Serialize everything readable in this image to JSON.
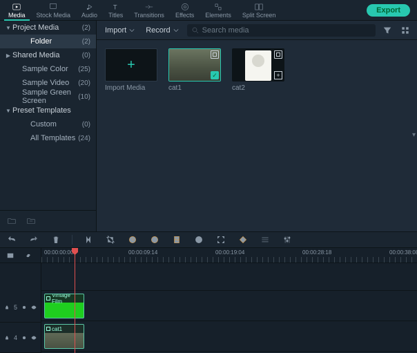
{
  "topTabs": [
    {
      "id": "media",
      "label": "Media"
    },
    {
      "id": "stock",
      "label": "Stock Media"
    },
    {
      "id": "audio",
      "label": "Audio"
    },
    {
      "id": "titles",
      "label": "Titles"
    },
    {
      "id": "transitions",
      "label": "Transitions"
    },
    {
      "id": "effects",
      "label": "Effects"
    },
    {
      "id": "elements",
      "label": "Elements"
    },
    {
      "id": "split",
      "label": "Split Screen"
    }
  ],
  "activeTopTab": "media",
  "exportLabel": "Export",
  "sidebar": [
    {
      "id": "projectmedia",
      "label": "Project Media",
      "count": "(2)",
      "tri": "▼",
      "indent": 0,
      "header": true
    },
    {
      "id": "folder",
      "label": "Folder",
      "count": "(2)",
      "indent": 2,
      "selected": true
    },
    {
      "id": "sharedmedia",
      "label": "Shared Media",
      "count": "(0)",
      "tri": "▶",
      "indent": 0,
      "header": true
    },
    {
      "id": "samplecolor",
      "label": "Sample Color",
      "count": "(25)",
      "indent": 1
    },
    {
      "id": "samplevideo",
      "label": "Sample Video",
      "count": "(20)",
      "indent": 1
    },
    {
      "id": "samplegreen",
      "label": "Sample Green Screen",
      "count": "(10)",
      "indent": 1
    },
    {
      "id": "preset",
      "label": "Preset Templates",
      "tri": "▼",
      "indent": 0,
      "header": true
    },
    {
      "id": "custom",
      "label": "Custom",
      "count": "(0)",
      "indent": 2
    },
    {
      "id": "alltemplates",
      "label": "All Templates",
      "count": "(24)",
      "indent": 2
    }
  ],
  "toolbar": {
    "import": "Import",
    "record": "Record",
    "searchPlaceholder": "Search media"
  },
  "mediaItems": [
    {
      "id": "import",
      "label": "Import Media",
      "import": true
    },
    {
      "id": "cat1",
      "label": "cat1",
      "selected": true,
      "thumb": "cat1"
    },
    {
      "id": "cat2",
      "label": "cat2",
      "thumb": "cat2"
    }
  ],
  "ruler": {
    "marks": [
      {
        "pos": 4,
        "label": "00:00:00:00"
      },
      {
        "pos": 126,
        "label": "00:00:09:14"
      },
      {
        "pos": 252,
        "label": "00:00:19:04"
      },
      {
        "pos": 378,
        "label": "00:00:28:18"
      },
      {
        "pos": 504,
        "label": "00:00:38:08"
      }
    ]
  },
  "tracks": [
    {
      "id": "5",
      "clips": [
        {
          "type": "green",
          "label": "Vintage Film"
        }
      ]
    },
    {
      "id": "4",
      "clips": [
        {
          "type": "video",
          "label": "cat1"
        }
      ]
    }
  ]
}
